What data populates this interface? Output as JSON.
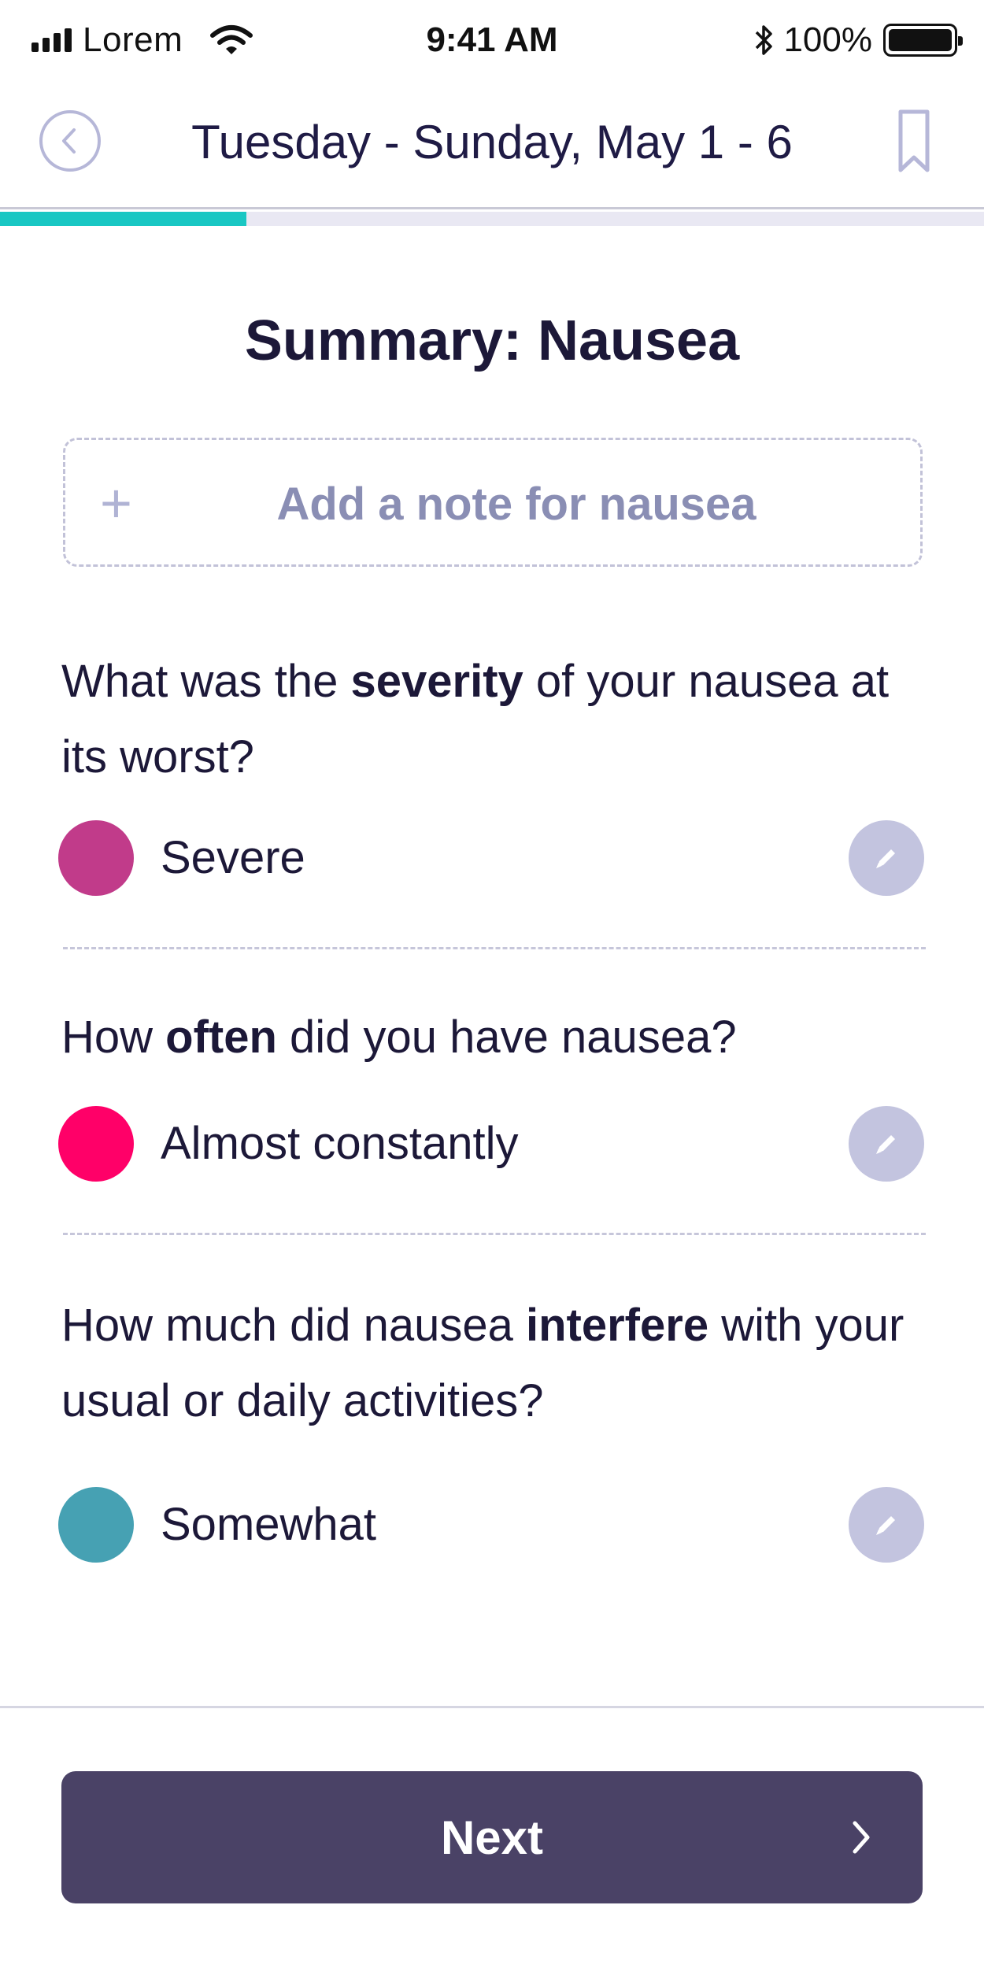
{
  "status_bar": {
    "carrier": "Lorem",
    "time": "9:41 AM",
    "battery": "100%",
    "icons": [
      "signal-icon",
      "wifi-icon",
      "bluetooth-icon",
      "battery-icon"
    ]
  },
  "header": {
    "title": "Tuesday - Sunday, May 1 - 6",
    "back_icon": "chevron-left-icon",
    "bookmark_icon": "bookmark-icon"
  },
  "progress": {
    "fraction": 0.25,
    "color": "#19c7c3"
  },
  "page": {
    "title": "Summary: Nausea"
  },
  "add_note": {
    "plus": "+",
    "label": "Add a note for nausea"
  },
  "questions": [
    {
      "text_before": "What was the ",
      "text_bold": "severity",
      "text_after": " of your nausea at its worst?",
      "answer": "Severe",
      "answer_color": "#c13b8a"
    },
    {
      "text_before": "How ",
      "text_bold": "often",
      "text_after": " did you have nausea?",
      "answer": "Almost constantly",
      "answer_color": "#ff0068"
    },
    {
      "text_before": "How much did nausea ",
      "text_bold": "interfere",
      "text_after": " with your usual or daily activities?",
      "answer": "Somewhat",
      "answer_color": "#46a1b3"
    }
  ],
  "footer": {
    "next_label": "Next"
  },
  "colors": {
    "accent": "#19c7c3",
    "button_bg": "#4a4266",
    "edit_bg": "#c3c4df"
  }
}
